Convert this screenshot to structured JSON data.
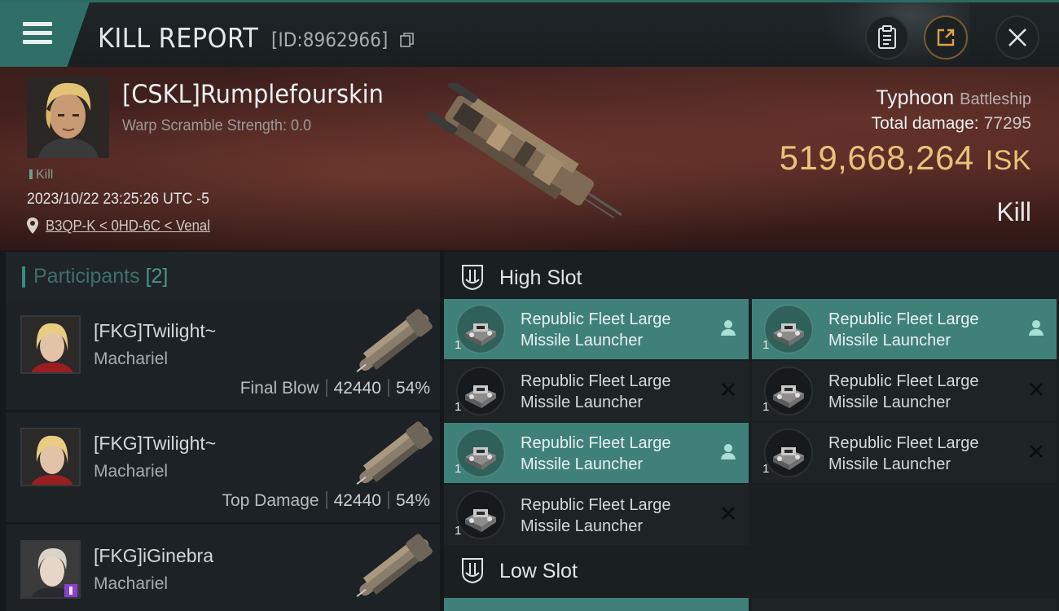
{
  "header": {
    "title": "KILL REPORT",
    "report_id": "[ID:8962966]"
  },
  "icons": {
    "menu": "hamburger-menu-icon",
    "copy": "copy-icon",
    "clipboard": "clipboard-icon",
    "share": "share-icon",
    "close": "close-icon",
    "location": "location-pin-icon",
    "slot": "slot-icon",
    "fleet": "fleet-member-icon",
    "destroyed": "destroyed-x-icon"
  },
  "victim": {
    "name": "[CSKL]Rumplefourskin",
    "scramble": "Warp Scramble Strength: 0.0",
    "tag": "Kill",
    "timestamp": "2023/10/22 23:25:26 UTC -5",
    "location": "B3QP-K < 0HD-6C < Venal",
    "ship": "Typhoon",
    "ship_class": "Battleship",
    "damage_label": "Total damage:",
    "damage": "77295",
    "isk": "519,668,264",
    "isk_unit": "ISK",
    "result": "Kill"
  },
  "participants": {
    "label": "Participants",
    "count": "[2]",
    "rows": [
      {
        "name": "[FKG]Twilight~",
        "ship": "Machariel",
        "role": "Final Blow",
        "damage": "42440",
        "percent": "54%"
      },
      {
        "name": "[FKG]Twilight~",
        "ship": "Machariel",
        "role": "Top Damage",
        "damage": "42440",
        "percent": "54%"
      },
      {
        "name": "[FKG]iGinebra",
        "ship": "Machariel",
        "role": "",
        "damage": "",
        "percent": ""
      }
    ]
  },
  "fitting": {
    "high_slot": "High Slot",
    "low_slot": "Low Slot",
    "modules": [
      {
        "name": "Republic Fleet Large Missile Launcher",
        "line1": "Republic Fleet Large",
        "line2": "Missile Launcher",
        "qty": "1",
        "state": "dropped"
      },
      {
        "name": "Republic Fleet Large Missile Launcher",
        "line1": "Republic Fleet Large",
        "line2": "Missile Launcher",
        "qty": "1",
        "state": "dropped"
      },
      {
        "name": "Republic Fleet Large Missile Launcher",
        "line1": "Republic Fleet Large",
        "line2": "Missile Launcher",
        "qty": "1",
        "state": "destroyed"
      },
      {
        "name": "Republic Fleet Large Missile Launcher",
        "line1": "Republic Fleet Large",
        "line2": "Missile Launcher",
        "qty": "1",
        "state": "destroyed"
      },
      {
        "name": "Republic Fleet Large Missile Launcher",
        "line1": "Republic Fleet Large",
        "line2": "Missile Launcher",
        "qty": "1",
        "state": "dropped"
      },
      {
        "name": "Republic Fleet Large Missile Launcher",
        "line1": "Republic Fleet Large",
        "line2": "Missile Launcher",
        "qty": "1",
        "state": "destroyed"
      },
      {
        "name": "Republic Fleet Large Missile Launcher",
        "line1": "Republic Fleet Large",
        "line2": "Missile Launcher",
        "qty": "1",
        "state": "destroyed"
      }
    ]
  },
  "colors": {
    "accent": "#3f8179",
    "isk": "#e9c27a",
    "banner": "#4a2420",
    "panel": "#1a1f22"
  }
}
